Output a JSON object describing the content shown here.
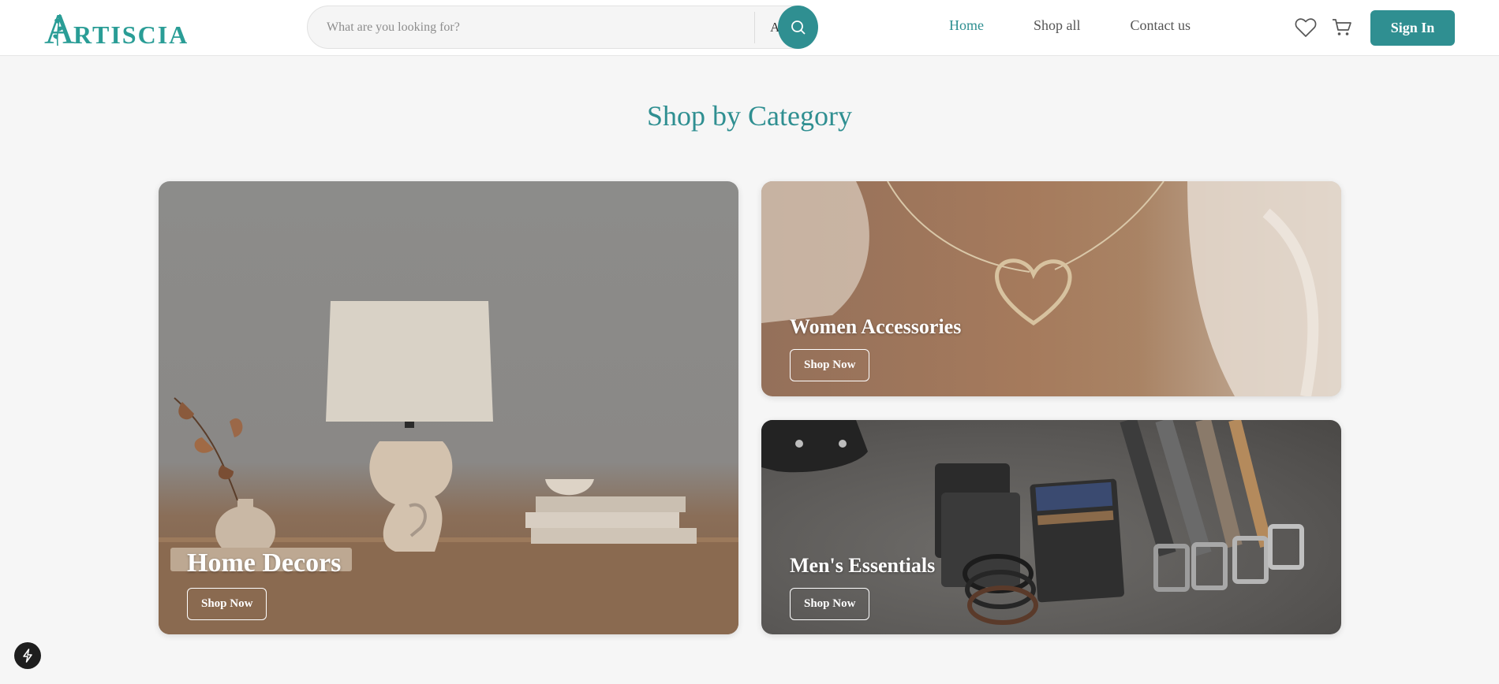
{
  "brand": {
    "logo_first": "A",
    "logo_rest": "RTISCIA",
    "color": "#2a9d96"
  },
  "search": {
    "placeholder": "What are you looking for?",
    "category": "All"
  },
  "nav": {
    "home": "Home",
    "shop_all": "Shop all",
    "contact": "Contact us"
  },
  "header": {
    "sign_in": "Sign In",
    "icons": [
      "heart-icon",
      "cart-icon"
    ]
  },
  "main": {
    "title": "Shop by Category",
    "categories": [
      {
        "title": "Home Decors",
        "button": "Shop Now"
      },
      {
        "title": "Women Accessories",
        "button": "Shop Now"
      },
      {
        "title": "Men's Essentials",
        "button": "Shop Now"
      }
    ]
  },
  "colors": {
    "accent": "#2f8f91",
    "background": "#f6f6f6"
  }
}
